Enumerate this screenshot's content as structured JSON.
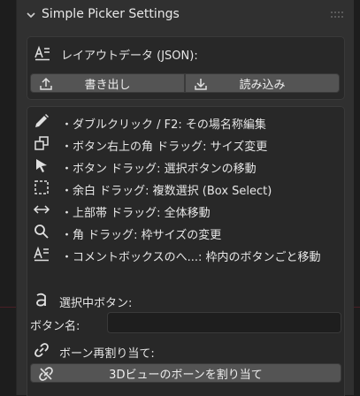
{
  "panel": {
    "title": "Simple Picker Settings"
  },
  "layout_section": {
    "heading": "レイアウトデータ (JSON):",
    "export_label": "書き出し",
    "import_label": "読み込み"
  },
  "help": {
    "items": [
      {
        "icon": "pencil-icon",
        "text": "・ダブルクリック / F2: その場名称編集"
      },
      {
        "icon": "resize-icon",
        "text": "・ボタン右上の角 ドラッグ: サイズ変更"
      },
      {
        "icon": "cursor-icon",
        "text": "・ボタン ドラッグ: 選択ボタンの移動"
      },
      {
        "icon": "box-select-icon",
        "text": "・余白 ドラッグ: 複数選択 (Box Select)"
      },
      {
        "icon": "arrows-horizontal-icon",
        "text": "・上部帯 ドラッグ: 全体移動"
      },
      {
        "icon": "magnifier-icon",
        "text": "・角 ドラッグ: 枠サイズの変更"
      },
      {
        "icon": "text-align-icon",
        "text": "・コメントボックスのへ...: 枠内のボタンごと移動"
      }
    ]
  },
  "selected": {
    "heading": "選択中ボタン:",
    "name_label": "ボタン名:",
    "name_value": ""
  },
  "bone": {
    "heading": "ボーン再割り当て:",
    "assign_label": "3Dビューのボーンを割り当て"
  }
}
